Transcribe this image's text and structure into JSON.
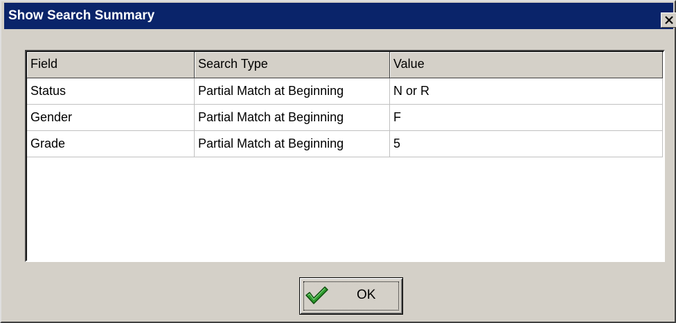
{
  "window": {
    "title": "Show Search Summary"
  },
  "grid": {
    "columns": [
      "Field",
      "Search Type",
      "Value"
    ],
    "rows": [
      [
        "Status",
        "Partial Match at Beginning",
        "N or R"
      ],
      [
        "Gender",
        "Partial Match at Beginning",
        "F"
      ],
      [
        "Grade",
        "Partial Match at Beginning",
        "5"
      ]
    ]
  },
  "buttons": {
    "ok_label": "OK",
    "ok_icon": "checkmark-icon",
    "close_icon": "close-icon"
  },
  "colors": {
    "titlebar": "#0a246a",
    "face": "#d4d0c8",
    "checkmark": "#2e9a2e"
  }
}
